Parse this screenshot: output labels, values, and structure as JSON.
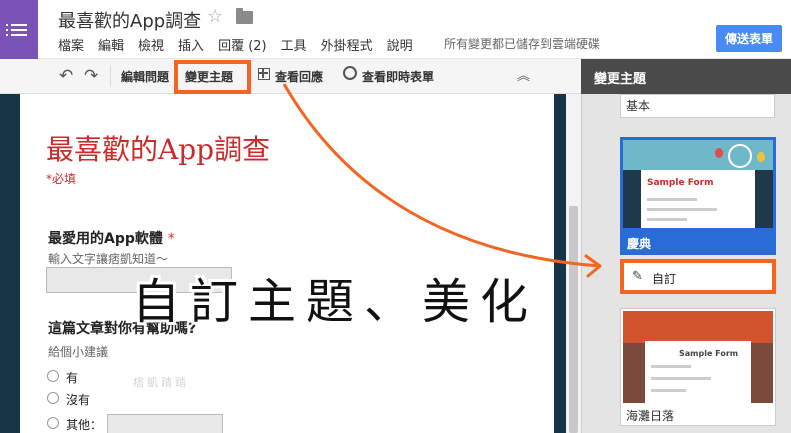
{
  "header": {
    "doc_title": "最喜歡的App調查",
    "star_icon": "star-icon",
    "folder_icon": "folder-icon",
    "menu": [
      "檔案",
      "編輯",
      "檢視",
      "插入",
      "回覆 (2)",
      "工具",
      "外掛程式",
      "說明"
    ],
    "save_status": "所有變更都已儲存到雲端硬碟",
    "send_button": "傳送表單"
  },
  "toolbar": {
    "undo_icon": "undo-icon",
    "redo_icon": "redo-icon",
    "edit_question": "編輯問題",
    "change_theme": "變更主題",
    "view_responses": "查看回應",
    "view_live_form": "查看即時表單"
  },
  "form": {
    "title": "最喜歡的App調查",
    "required_note": "*必填",
    "questions": [
      {
        "title": "最愛用的App軟體",
        "required_mark": "*",
        "help": "輸入文字讓痞凱知道～"
      },
      {
        "title": "這篇文章對你有幫助嗎?",
        "help": "給個小建議"
      }
    ],
    "options": [
      "有",
      "沒有",
      "其他："
    ]
  },
  "theme_panel": {
    "title": "變更主題",
    "themes": [
      {
        "name": "基本"
      },
      {
        "name": "慶典",
        "thumb_title": "Sample Form",
        "selected": true
      },
      {
        "name": "海灘日落",
        "thumb_title": "Sample Form"
      }
    ],
    "custom_label": "自訂",
    "custom_icon": "pencil-icon"
  },
  "annotation": {
    "text": "自訂主題、美化",
    "watermark": "痞凱踏踏"
  },
  "colors": {
    "app_purple": "#7a52b8",
    "accent_blue": "#4a8af4",
    "selected_blue": "#2a6cd6",
    "highlight_orange": "#f26522",
    "form_title_red": "#cc2b2b",
    "canvas_dark": "#163547"
  }
}
